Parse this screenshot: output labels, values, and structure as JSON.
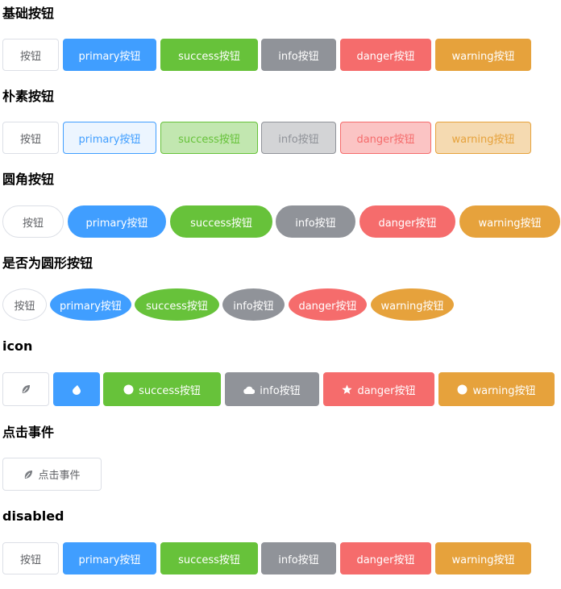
{
  "sections": {
    "basic": {
      "title": "基础按钮",
      "buttons": [
        "按钮",
        "primary按钮",
        "success按钮",
        "info按钮",
        "danger按钮",
        "warning按钮"
      ]
    },
    "plain": {
      "title": "朴素按钮",
      "buttons": [
        "按钮",
        "primary按钮",
        "success按钮",
        "info按钮",
        "danger按钮",
        "warning按钮"
      ]
    },
    "round": {
      "title": "圆角按钮",
      "buttons": [
        "按钮",
        "primary按钮",
        "success按钮",
        "info按钮",
        "danger按钮",
        "warning按钮"
      ]
    },
    "circle": {
      "title": "是否为圆形按钮",
      "buttons": [
        "按钮",
        "primary按钮",
        "success按钮",
        "info按钮",
        "danger按钮",
        "warning按钮"
      ]
    },
    "icon": {
      "title": "icon",
      "buttons": [
        "",
        "",
        "success按钮",
        "info按钮",
        "danger按钮",
        "warning按钮"
      ]
    },
    "click": {
      "title": "点击事件",
      "button": "点击事件"
    },
    "disabled": {
      "title": "disabled",
      "buttons": [
        "按钮",
        "primary按钮",
        "success按钮",
        "info按钮",
        "danger按钮",
        "warning按钮"
      ]
    }
  },
  "colors": {
    "primary": "#409eff",
    "success": "#67c23a",
    "info": "#909399",
    "danger": "#f56c6c",
    "warning": "#e6a23c",
    "default_border": "#dcdfe6",
    "default_text": "#606266"
  },
  "icons": {
    "icon_row": [
      "leaf-icon",
      "drop-icon",
      "circle-icon",
      "cloud-icon",
      "star-icon",
      "circle-icon"
    ],
    "click_button": "leaf-icon"
  }
}
